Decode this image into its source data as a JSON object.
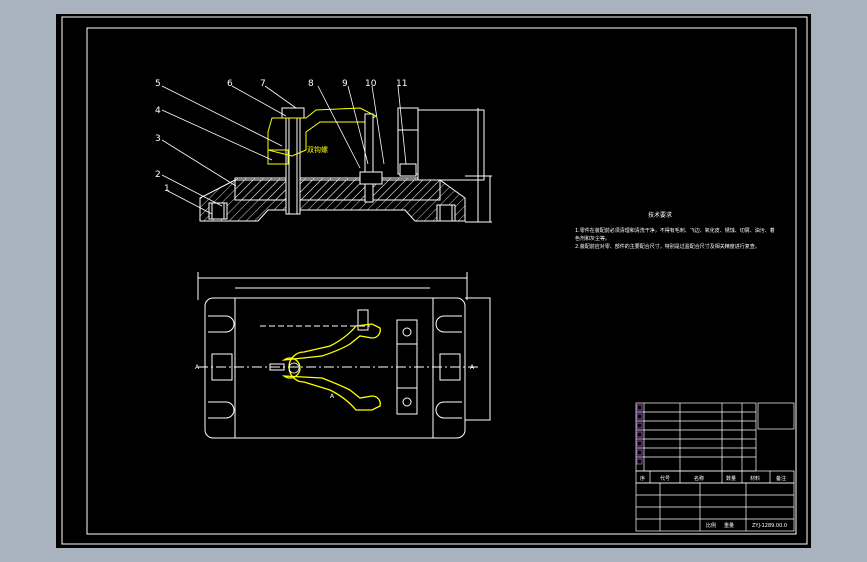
{
  "part_balloons": [
    "1",
    "2",
    "3",
    "4",
    "5",
    "6",
    "7",
    "8",
    "9",
    "10",
    "11"
  ],
  "clamp_label": "双钩螺",
  "tech_requirements": {
    "title": "技术要求",
    "lines": [
      "1.零件在装配前必须清理和清洗干净，不得有毛刺、飞边、氧化皮、锈蚀、切屑、油污、着",
      "色剂和灰尘等。",
      "2.装配前应对零、部件的主要配合尺寸，特别是过盈配合尺寸及相关精度进行复查。"
    ]
  },
  "section_marks": {
    "a_left": "A",
    "a_right": "A",
    "a_view": "A"
  },
  "title_block": {
    "header_cells": [
      "序",
      "代号",
      "名称",
      "数量",
      "材料",
      "备注"
    ],
    "drawing_no": "ZYJ-1289.00.0",
    "scale_label": "比例",
    "weight_label": "重量"
  }
}
